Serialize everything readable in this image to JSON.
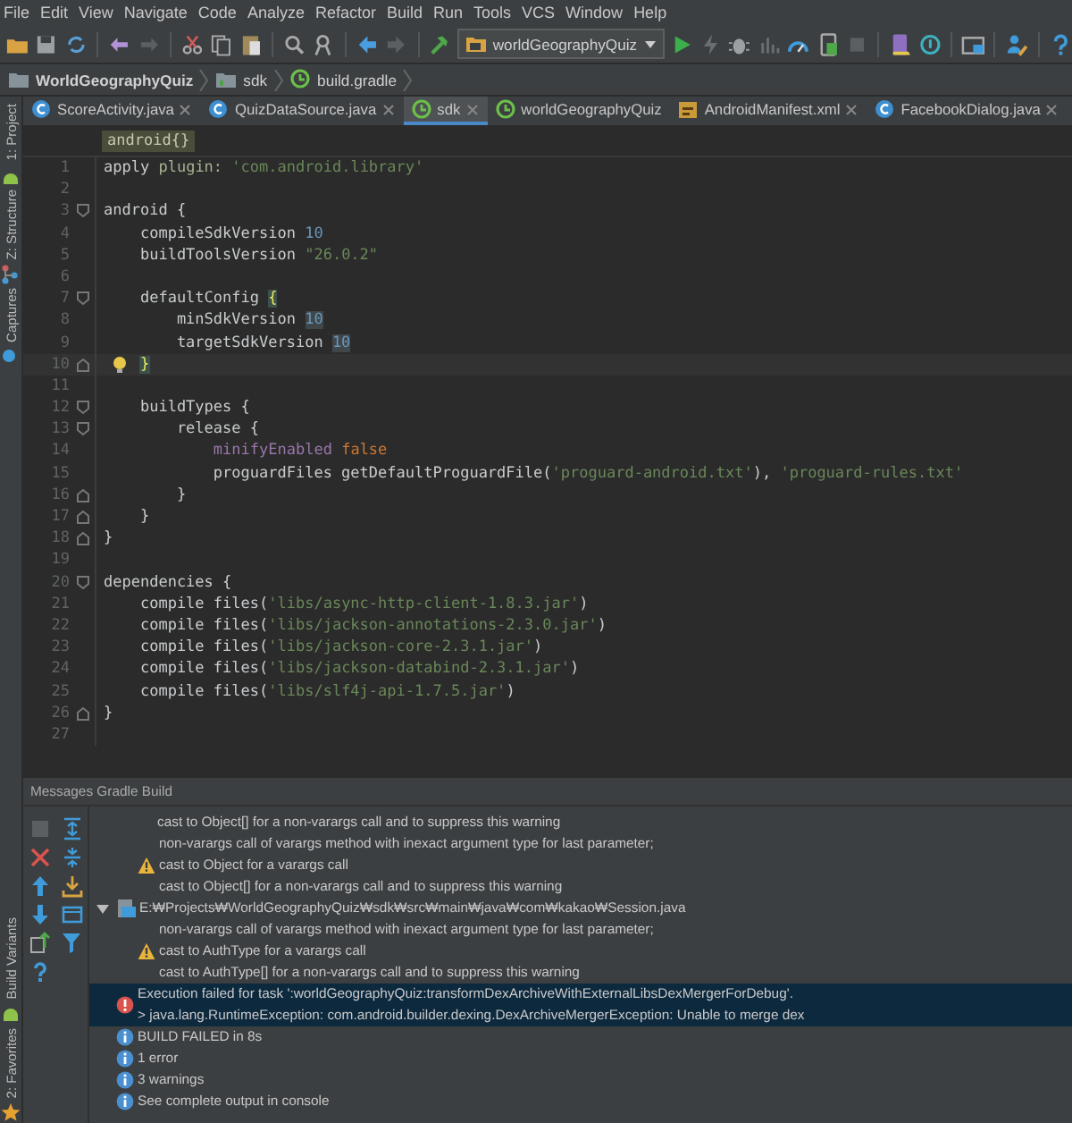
{
  "menu": [
    "File",
    "Edit",
    "View",
    "Navigate",
    "Code",
    "Analyze",
    "Refactor",
    "Build",
    "Run",
    "Tools",
    "VCS",
    "Window",
    "Help"
  ],
  "toolbar": {
    "run_config": "worldGeographyQuiz"
  },
  "breadcrumbs": [
    {
      "label": "WorldGeographyQuiz",
      "kind": "project"
    },
    {
      "label": "sdk",
      "kind": "module"
    },
    {
      "label": "build.gradle",
      "kind": "gradle"
    }
  ],
  "side_tabs": [
    {
      "label": "1: Project",
      "kind": "top"
    },
    {
      "label": "Z: Structure",
      "kind": "top"
    },
    {
      "label": "Captures",
      "kind": "top"
    },
    {
      "label": "Build Variants",
      "kind": "bottom"
    },
    {
      "label": "2: Favorites",
      "kind": "bottom"
    }
  ],
  "tabs": [
    {
      "label": "ScoreActivity.java",
      "kind": "java",
      "selected": false,
      "closable": true
    },
    {
      "label": "QuizDataSource.java",
      "kind": "java",
      "selected": false,
      "closable": true
    },
    {
      "label": "sdk",
      "kind": "gradle",
      "selected": true,
      "closable": true
    },
    {
      "label": "worldGeographyQuiz",
      "kind": "gradle",
      "selected": false,
      "closable": false
    },
    {
      "label": "AndroidManifest.xml",
      "kind": "xml",
      "selected": false,
      "closable": true
    },
    {
      "label": "FacebookDialog.java",
      "kind": "java",
      "selected": false,
      "closable": true
    }
  ],
  "editor": {
    "scope": "android{}",
    "lines": [
      {
        "n": "1",
        "fold_start": false,
        "fold_end": false,
        "current": false,
        "tokens": [
          {
            "t": "apply ",
            "kind": "plain"
          },
          {
            "t": "plugin: ",
            "kind": "label"
          },
          {
            "t": "'com.android.library'",
            "kind": "string"
          }
        ]
      },
      {
        "n": "2",
        "fold_start": false,
        "fold_end": false,
        "current": false
      },
      {
        "n": "3",
        "fold_start": true,
        "fold_end": false,
        "current": false,
        "tokens": [
          {
            "t": "android {",
            "kind": "plain"
          }
        ]
      },
      {
        "n": "4",
        "fold_start": false,
        "fold_end": false,
        "current": false,
        "tokens": [
          {
            "t": "    compileSdkVersion ",
            "kind": "plain"
          },
          {
            "t": "10",
            "kind": "number"
          }
        ]
      },
      {
        "n": "5",
        "fold_start": false,
        "fold_end": false,
        "current": false,
        "tokens": [
          {
            "t": "    buildToolsVersion ",
            "kind": "plain"
          },
          {
            "t": "\"26.0.2\"",
            "kind": "string"
          }
        ]
      },
      {
        "n": "6",
        "fold_start": false,
        "fold_end": false,
        "current": false
      },
      {
        "n": "7",
        "fold_start": true,
        "fold_end": false,
        "current": false,
        "tokens": [
          {
            "t": "    defaultConfig ",
            "kind": "plain"
          },
          {
            "t": "{",
            "kind": "brace"
          }
        ]
      },
      {
        "n": "8",
        "fold_start": false,
        "fold_end": false,
        "current": false,
        "tokens": [
          {
            "t": "        minSdkVersion ",
            "kind": "plain"
          },
          {
            "t": "10",
            "kind": "usage"
          }
        ]
      },
      {
        "n": "9",
        "fold_start": false,
        "fold_end": false,
        "current": false,
        "tokens": [
          {
            "t": "        targetSdkVersion ",
            "kind": "plain"
          },
          {
            "t": "10",
            "kind": "usage"
          }
        ]
      },
      {
        "n": "10",
        "fold_start": false,
        "fold_end": true,
        "current": true,
        "tokens": [
          {
            "t": "    }",
            "kind": "brace"
          }
        ]
      },
      {
        "n": "11",
        "fold_start": false,
        "fold_end": false,
        "current": false
      },
      {
        "n": "12",
        "fold_start": true,
        "fold_end": false,
        "current": false,
        "tokens": [
          {
            "t": "    buildTypes {",
            "kind": "plain"
          }
        ]
      },
      {
        "n": "13",
        "fold_start": true,
        "fold_end": false,
        "current": false,
        "tokens": [
          {
            "t": "        release {",
            "kind": "plain"
          }
        ]
      },
      {
        "n": "14",
        "fold_start": false,
        "fold_end": false,
        "current": false,
        "tokens": [
          {
            "t": "            minifyEnabled ",
            "kind": "prop"
          },
          {
            "t": "false",
            "kind": "keyword"
          }
        ]
      },
      {
        "n": "15",
        "fold_start": false,
        "fold_end": false,
        "current": false,
        "tokens": [
          {
            "t": "            proguardFiles getDefaultProguardFile(",
            "kind": "plain"
          },
          {
            "t": "'proguard-android.txt'",
            "kind": "string"
          },
          {
            "t": "), ",
            "kind": "plain"
          },
          {
            "t": "'proguard-rules.txt'",
            "kind": "string"
          }
        ]
      },
      {
        "n": "16",
        "fold_start": false,
        "fold_end": true,
        "current": false,
        "tokens": [
          {
            "t": "        }",
            "kind": "plain"
          }
        ]
      },
      {
        "n": "17",
        "fold_start": false,
        "fold_end": true,
        "current": false,
        "tokens": [
          {
            "t": "    }",
            "kind": "plain"
          }
        ]
      },
      {
        "n": "18",
        "fold_start": false,
        "fold_end": true,
        "current": false,
        "tokens": [
          {
            "t": "}",
            "kind": "plain"
          }
        ]
      },
      {
        "n": "19",
        "fold_start": false,
        "fold_end": false,
        "current": false
      },
      {
        "n": "20",
        "fold_start": true,
        "fold_end": false,
        "current": false,
        "tokens": [
          {
            "t": "dependencies {",
            "kind": "plain"
          }
        ]
      },
      {
        "n": "21",
        "fold_start": false,
        "fold_end": false,
        "current": false,
        "tokens": [
          {
            "t": "    compile files(",
            "kind": "plain"
          },
          {
            "t": "'libs/async-http-client-1.8.3.jar'",
            "kind": "string"
          },
          {
            "t": ")",
            "kind": "plain"
          }
        ]
      },
      {
        "n": "22",
        "fold_start": false,
        "fold_end": false,
        "current": false,
        "tokens": [
          {
            "t": "    compile files(",
            "kind": "plain"
          },
          {
            "t": "'libs/jackson-annotations-2.3.0.jar'",
            "kind": "string"
          },
          {
            "t": ")",
            "kind": "plain"
          }
        ]
      },
      {
        "n": "23",
        "fold_start": false,
        "fold_end": false,
        "current": false,
        "tokens": [
          {
            "t": "    compile files(",
            "kind": "plain"
          },
          {
            "t": "'libs/jackson-core-2.3.1.jar'",
            "kind": "string"
          },
          {
            "t": ")",
            "kind": "plain"
          }
        ]
      },
      {
        "n": "24",
        "fold_start": false,
        "fold_end": false,
        "current": false,
        "tokens": [
          {
            "t": "    compile files(",
            "kind": "plain"
          },
          {
            "t": "'libs/jackson-databind-2.3.1.jar'",
            "kind": "string"
          },
          {
            "t": ")",
            "kind": "plain"
          }
        ]
      },
      {
        "n": "25",
        "fold_start": false,
        "fold_end": false,
        "current": false,
        "tokens": [
          {
            "t": "    compile files(",
            "kind": "plain"
          },
          {
            "t": "'libs/slf4j-api-1.7.5.jar'",
            "kind": "string"
          },
          {
            "t": ")",
            "kind": "plain"
          }
        ]
      },
      {
        "n": "26",
        "fold_start": false,
        "fold_end": true,
        "current": false,
        "tokens": [
          {
            "t": "}",
            "kind": "plain"
          }
        ]
      },
      {
        "n": "27",
        "fold_start": false,
        "fold_end": false,
        "current": false
      }
    ]
  },
  "messages": {
    "title": "Messages Gradle Build",
    "items": [
      {
        "kind": "text",
        "selected": false,
        "lines": [
          "cast to Object[] for a non-varargs call and to suppress this warning"
        ]
      },
      {
        "kind": "warning",
        "selected": false,
        "lines": [
          "non-varargs call of varargs method with inexact argument type for last parameter;",
          "cast to Object for a varargs call",
          "cast to Object[] for a non-varargs call and to suppress this warning"
        ]
      },
      {
        "kind": "file",
        "selected": false,
        "expanded": true,
        "lines": [
          "E:₩Projects₩WorldGeographyQuiz₩sdk₩src₩main₩java₩com₩kakao₩Session.java"
        ]
      },
      {
        "kind": "warning",
        "selected": false,
        "lines": [
          "non-varargs call of varargs method with inexact argument type for last parameter;",
          "cast to AuthType for a varargs call",
          "cast to AuthType[] for a non-varargs call and to suppress this warning"
        ]
      },
      {
        "kind": "error",
        "selected": true,
        "lines": [
          "Execution failed for task ':worldGeographyQuiz:transformDexArchiveWithExternalLibsDexMergerForDebug'.",
          "> java.lang.RuntimeException: com.android.builder.dexing.DexArchiveMergerException: Unable to merge dex"
        ]
      },
      {
        "kind": "info",
        "selected": false,
        "lines": [
          "BUILD FAILED in 8s"
        ]
      },
      {
        "kind": "info",
        "selected": false,
        "lines": [
          "1 error"
        ]
      },
      {
        "kind": "info",
        "selected": false,
        "lines": [
          "3 warnings"
        ]
      },
      {
        "kind": "info",
        "selected": false,
        "lines": [
          "See complete output in console"
        ]
      }
    ]
  }
}
